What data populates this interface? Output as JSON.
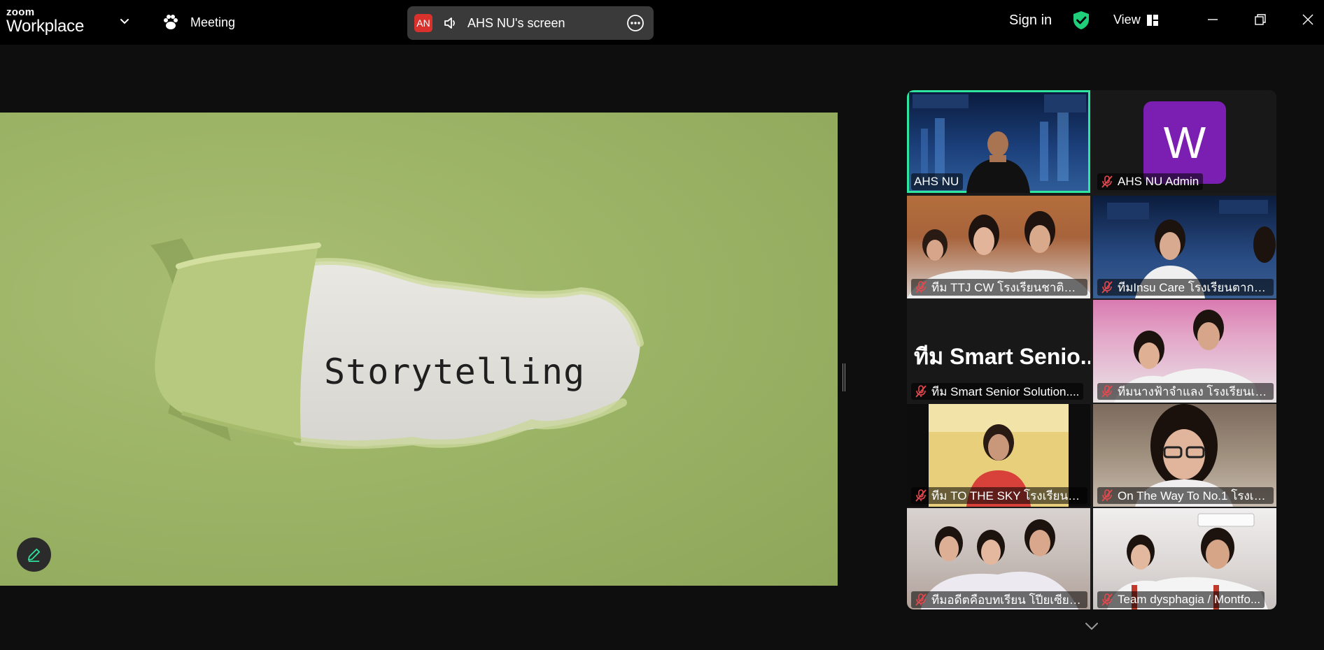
{
  "app": {
    "brand_top": "zoom",
    "brand_name": "Workplace"
  },
  "header": {
    "meeting_label": "Meeting",
    "share_avatar": "AN",
    "share_label": "AHS NU's screen",
    "signin_label": "Sign in",
    "view_label": "View"
  },
  "shared_content": {
    "slide_text": "Storytelling"
  },
  "gallery": {
    "tiles": [
      {
        "name": "AHS NU",
        "muted": false,
        "active": true
      },
      {
        "name": "AHS NU Admin",
        "muted": true,
        "avatar_letter": "W"
      },
      {
        "name": "ทีม TTJ CW โรงเรียนชาติตระ...",
        "muted": true
      },
      {
        "name": "ทีมInsu Care โรงเรียนตากพิ...",
        "muted": true
      },
      {
        "name": "ทีม Smart Senior Solution....",
        "muted": true,
        "big_name": "ทีม Smart Senio..."
      },
      {
        "name": "ทีมนางฟ้าจำแลง โรงเรียนเตรีย...",
        "muted": true
      },
      {
        "name": "ทีม TO THE SKY โรงเรียนเพ...",
        "muted": true
      },
      {
        "name": "On The Way To No.1 โรงเรี...",
        "muted": true
      },
      {
        "name": "ทีมอดีตคือบทเรียน โปียเซียนคี...",
        "muted": true
      },
      {
        "name": "Team dysphagia / Montfo...",
        "muted": true
      }
    ]
  },
  "colors": {
    "accent_green": "#2ee6a0",
    "share_avatar_red": "#d9322d",
    "admin_avatar_purple": "#7b1fb2",
    "mute_red": "#e5484d"
  }
}
